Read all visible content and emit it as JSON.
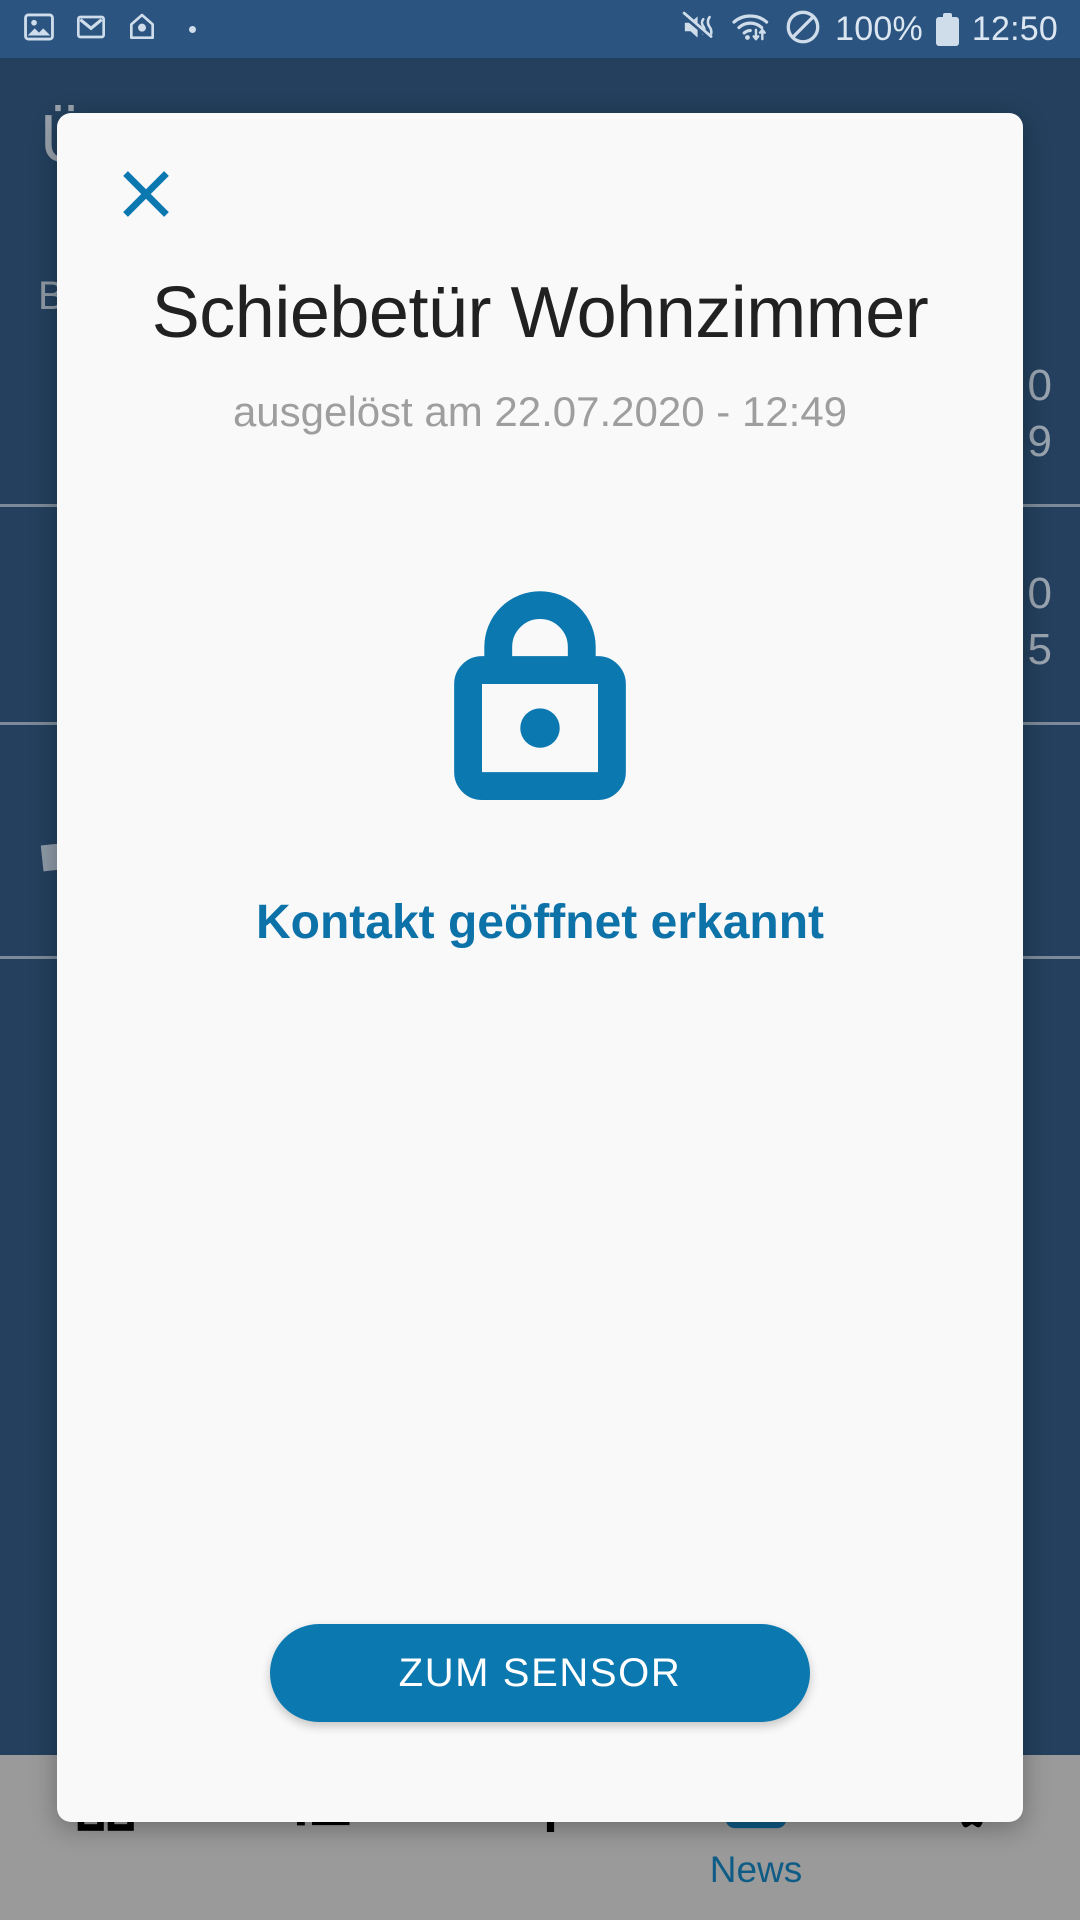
{
  "status_bar": {
    "icons_left": [
      "image-icon",
      "gmail-icon",
      "home-icon",
      "notification-dot"
    ],
    "icons_right": [
      "mute-icon",
      "wifi-icon",
      "do-not-disturb-icon",
      "battery-icon"
    ],
    "battery_percent": "100%",
    "clock": "12:50"
  },
  "background_app": {
    "title": "Übersicht",
    "subtitle": "B",
    "values": [
      "0\n9",
      "0\n5"
    ]
  },
  "dialog": {
    "close_icon": "close-icon",
    "title": "Schiebetür Wohnzimmer",
    "subtitle": "ausgelöst am 22.07.2020 - 12:49",
    "state_icon": "lock-closed-icon",
    "state_text": "Kontakt geöffnet erkannt",
    "action_label": "ZUM SENSOR"
  },
  "bottom_nav": {
    "items": [
      {
        "label": "",
        "icon": "dashboard-icon",
        "active": false
      },
      {
        "label": "",
        "icon": "list-icon",
        "active": false
      },
      {
        "label": "",
        "icon": "sliders-icon",
        "active": false
      },
      {
        "label": "News",
        "icon": "news-icon",
        "active": true
      },
      {
        "label": "",
        "icon": "gear-icon",
        "active": false
      }
    ]
  },
  "colors": {
    "accent_blue": "#0b78b0",
    "status_blue": "#0d72a8",
    "app_navy": "#24405e",
    "status_bar": "#2b5480",
    "nav_bar": "#9a9a9a",
    "nav_active": "#0e5c86",
    "dialog_bg": "#f9f9fa",
    "title_text": "#212121",
    "subtitle_text": "#9e9e9e"
  }
}
